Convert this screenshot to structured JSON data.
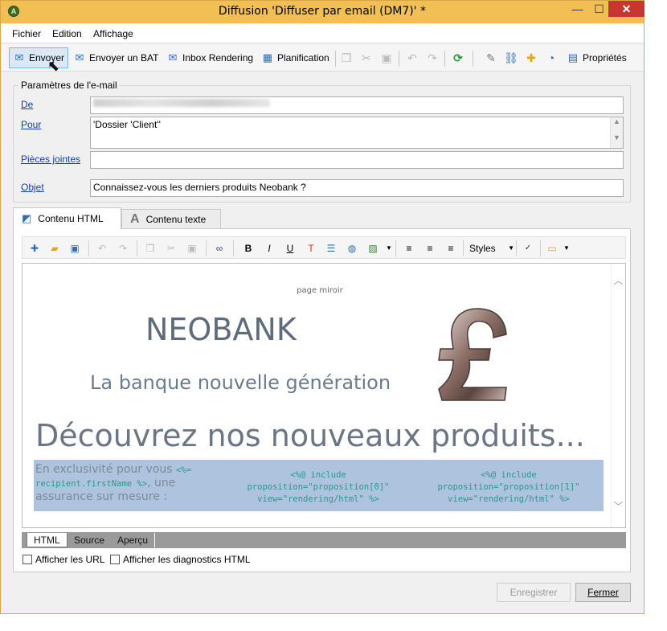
{
  "window": {
    "title": "Diffusion 'Diffuser par email (DM7)' *",
    "app_icon_label": "A",
    "minimize_label": "—",
    "maximize_label": "☐",
    "close_label": "✕"
  },
  "menu": {
    "items": [
      "Fichier",
      "Edition",
      "Affichage"
    ]
  },
  "toolbar": {
    "send_label": "Envoyer",
    "send_bat_label": "Envoyer un BAT",
    "inbox_rendering_label": "Inbox Rendering",
    "planning_label": "Planification",
    "properties_label": "Propriétés"
  },
  "email_params": {
    "legend": "Paramètres de l'e-mail",
    "from_label": "De",
    "from_value": "",
    "to_label": "Pour",
    "to_value": "'Dossier 'Client''",
    "attachments_label": "Pièces jointes",
    "attachments_value": "",
    "subject_label": "Objet",
    "subject_value": "Connaissez-vous les derniers produits Neobank ?"
  },
  "tabs": {
    "html_tab": "Contenu HTML",
    "text_tab": "Contenu texte"
  },
  "editor_toolbar": {
    "bold": "B",
    "italic": "I",
    "underline": "U",
    "styles_label": "Styles"
  },
  "content": {
    "mirror_link": "page miroir",
    "brand": "NEOBANK",
    "tagline": "La banque nouvelle génération",
    "headline": "Découvrez nos nouveaux produits...",
    "exclusivity_part1": "En exclusivité pour vous ",
    "exclusivity_code": "<%= recipient.firstName %>",
    "exclusivity_part2": ", une assurance sur mesure :",
    "include_1_line1": "<%@ include",
    "include_1_line2": "proposition=\"proposition[0]\"",
    "include_1_line3": "view=\"rendering/html\" %>",
    "include_2_line1": "<%@ include",
    "include_2_line2": "proposition=\"proposition[1]\"",
    "include_2_line3": "view=\"rendering/html\" %>"
  },
  "view_tabs": [
    "HTML",
    "Source",
    "Aperçu"
  ],
  "options": {
    "show_urls": "Afficher les URL",
    "show_diagnostics": "Afficher les diagnostics HTML"
  },
  "footer": {
    "save_label": "Enregistrer",
    "close_label": "Fermer"
  },
  "colors": {
    "titlebar": "#f2bf55",
    "close_button": "#c7372f",
    "link": "#0b3fb8",
    "band": "#adc3de",
    "code": "#2a9a8a"
  }
}
